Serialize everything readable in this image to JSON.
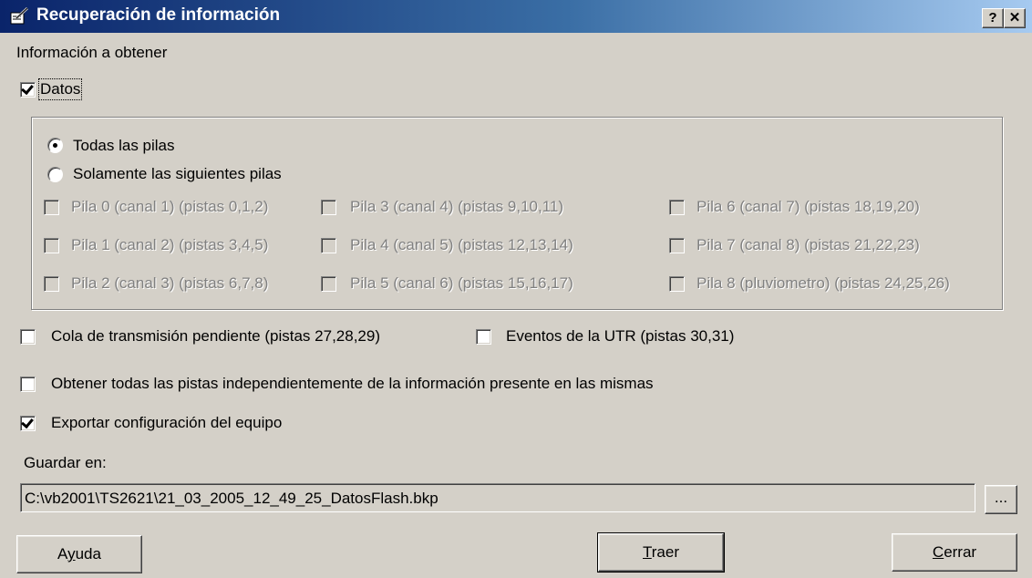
{
  "window": {
    "title": "Recuperación de información",
    "help_label": "?",
    "close_label": "✕"
  },
  "info_label": "Información a obtener",
  "datos": {
    "label": "Datos",
    "checked": true
  },
  "pilas_mode": {
    "all_label": "Todas las pilas",
    "some_label": "Solamente las siguientes pilas",
    "selected": "all"
  },
  "pilas": [
    "Pila 0 (canal 1) (pistas 0,1,2)",
    "Pila 3 (canal 4) (pistas 9,10,11)",
    "Pila 6 (canal 7) (pistas 18,19,20)",
    "Pila 1 (canal 2) (pistas 3,4,5)",
    "Pila 4 (canal 5) (pistas 12,13,14)",
    "Pila 7 (canal 8) (pistas 21,22,23)",
    "Pila 2 (canal 3) (pistas 6,7,8)",
    "Pila 5 (canal 6) (pistas 15,16,17)",
    "Pila 8 (pluviometro) (pistas 24,25,26)"
  ],
  "options": {
    "cola": {
      "label": "Cola de transmisión pendiente (pistas 27,28,29)",
      "checked": false
    },
    "eventos": {
      "label": "Eventos de la UTR (pistas 30,31)",
      "checked": false
    },
    "todas_pistas": {
      "label": "Obtener todas las pistas independientemente de la información presente en las mismas",
      "checked": false
    },
    "exportar": {
      "label": "Exportar configuración del equipo",
      "checked": true
    }
  },
  "save": {
    "label": "Guardar en:",
    "path": "C:\\vb2001\\TS2621\\21_03_2005_12_49_25_DatosFlash.bkp",
    "browse_label": "..."
  },
  "buttons": {
    "ayuda_pre": "A",
    "ayuda_u": "y",
    "ayuda_post": "uda",
    "traer_u": "T",
    "traer_post": "raer",
    "cerrar_u": "C",
    "cerrar_post": "errar"
  }
}
